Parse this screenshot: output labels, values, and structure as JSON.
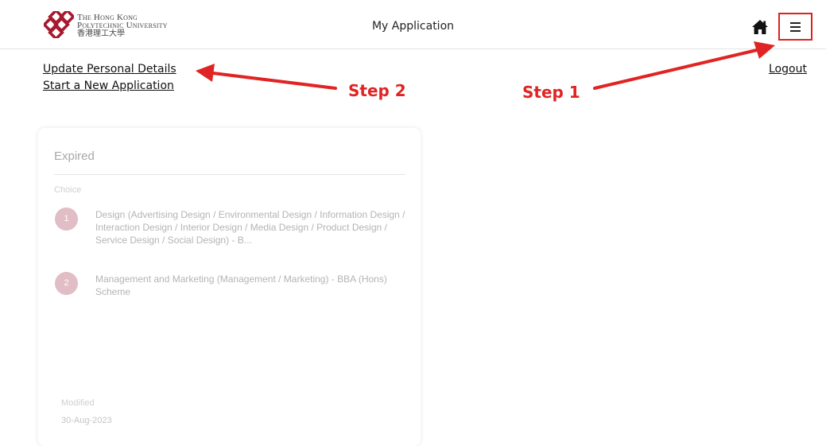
{
  "header": {
    "logo": {
      "line1": "The Hong Kong",
      "line2": "Polytechnic University",
      "line3": "香港理工大學"
    },
    "title": "My Application",
    "home_icon": "home-icon",
    "menu_icon": "hamburger-menu-icon"
  },
  "links": {
    "update_personal_details": "Update Personal Details",
    "start_new_application": "Start a New Application",
    "logout": "Logout"
  },
  "annotations": {
    "step1": "Step 1",
    "step2": "Step 2",
    "color": "#e02424"
  },
  "application_card": {
    "status": "Expired",
    "choice_label": "Choice",
    "choices": [
      {
        "number": "1",
        "text": "Design (Advertising Design / Environmental Design / Information Design / Interaction Design / Interior Design / Media Design / Product Design / Service Design / Social Design) - B..."
      },
      {
        "number": "2",
        "text": "Management and Marketing (Management / Marketing) - BBA (Hons) Scheme"
      }
    ],
    "modified_label": "Modified",
    "modified_date": "30-Aug-2023"
  },
  "colors": {
    "brand": "#a6192e",
    "choice_badge": "#e1bdc5",
    "annotation_red": "#e02424"
  }
}
